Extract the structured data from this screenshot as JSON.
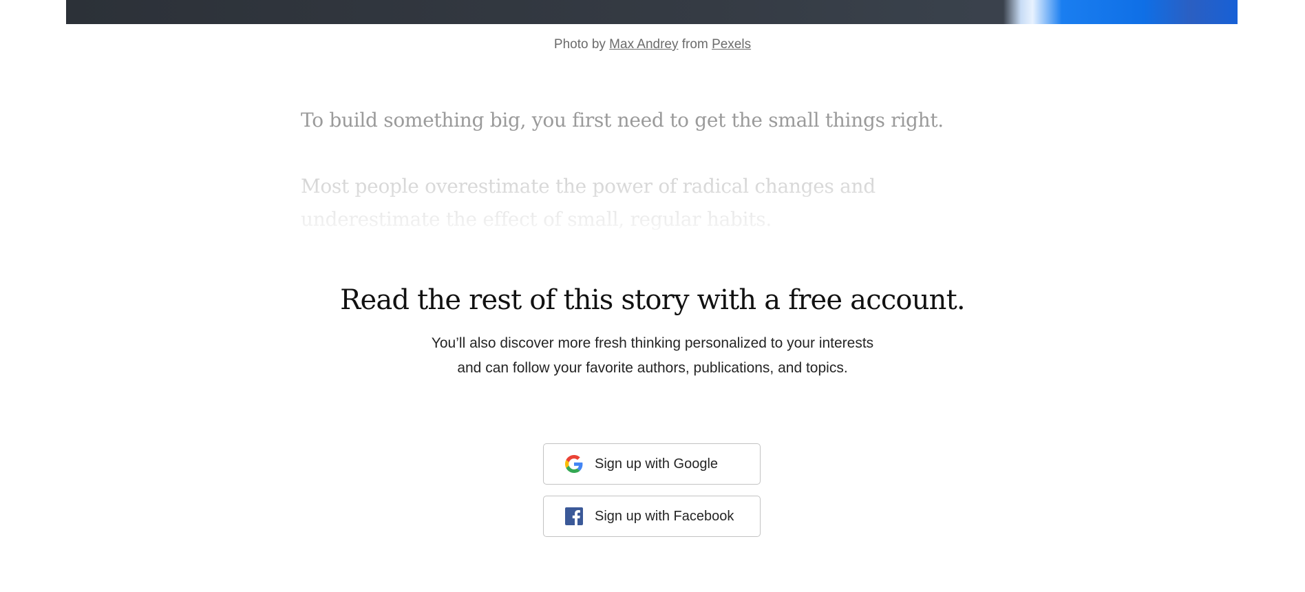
{
  "caption": {
    "prefix": "Photo by",
    "author_link": "Max Andrey",
    "middle": "from",
    "source_link": "Pexels"
  },
  "article": {
    "paragraph_1": "To build something big, you first need to get the small things right.",
    "paragraph_2": "Most people overestimate the power of radical changes and underestimate the effect of small, regular habits."
  },
  "paywall": {
    "title": "Read the rest of this story with a free account.",
    "subtitle_line_1": "You’ll also discover more fresh thinking personalized to your interests",
    "subtitle_line_2": "and can follow your favorite authors, publications, and topics."
  },
  "signup": {
    "google_label": "Sign up with Google",
    "facebook_label": "Sign up with Facebook",
    "google_icon": "google-g-icon",
    "facebook_icon": "facebook-f-icon"
  },
  "colors": {
    "facebook_blue": "#3b5998",
    "google_blue": "#4285F4",
    "google_red": "#EA4335",
    "google_yellow": "#FBBC05",
    "google_green": "#34A853"
  }
}
